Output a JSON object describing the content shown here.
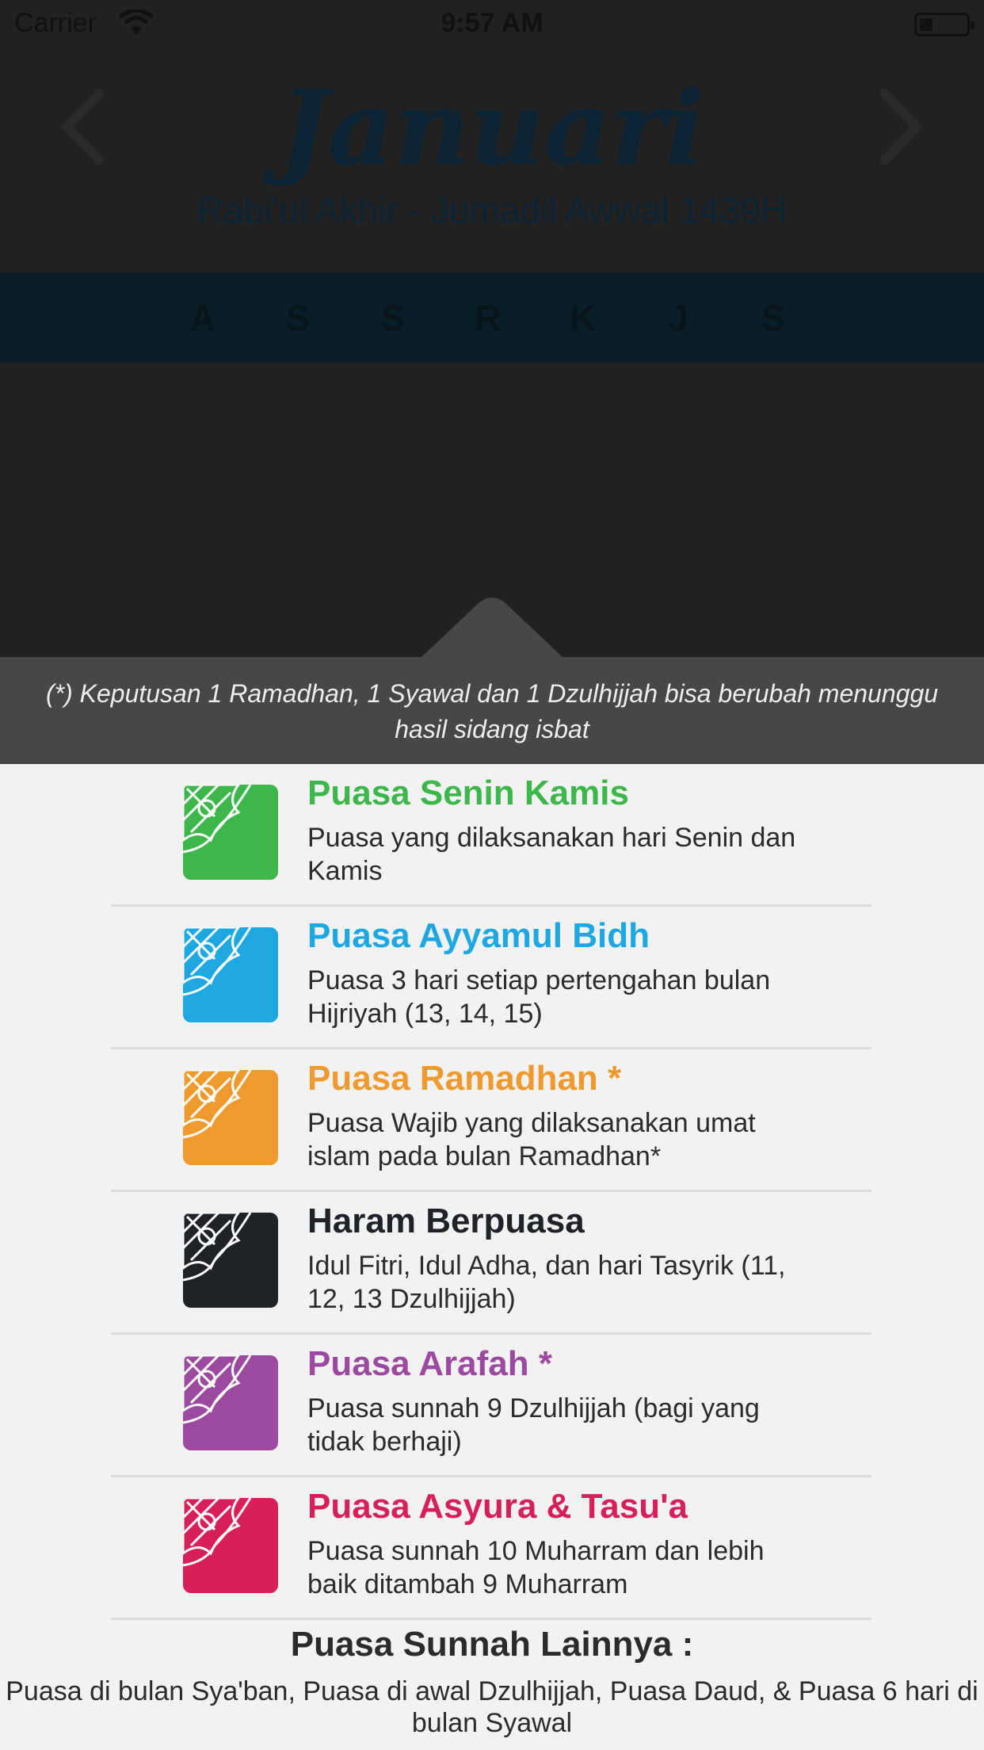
{
  "status_bar": {
    "carrier": "Carrier",
    "time": "9:57 AM"
  },
  "calendar": {
    "month": "Januari",
    "hijri_range": "Rabi'ul Akhir - Jumadil Awwal 1439H",
    "weekdays": [
      "A",
      "S",
      "S",
      "R",
      "K",
      "J",
      "S"
    ]
  },
  "notice": "(*) Keputusan 1 Ramadhan, 1 Syawal dan 1 Dzulhijjah bisa berubah menunggu hasil sidang isbat",
  "legend": [
    {
      "title": "Puasa Senin Kamis",
      "desc": "Puasa yang dilaksanakan hari Senin dan Kamis",
      "color": "#3db74b"
    },
    {
      "title": "Puasa Ayyamul Bidh",
      "desc": "Puasa 3 hari setiap pertengahan bulan Hijriyah (13, 14, 15)",
      "color": "#1ea7e0"
    },
    {
      "title": "Puasa Ramadhan *",
      "desc": "Puasa Wajib yang dilaksanakan umat islam pada bulan Ramadhan*",
      "color": "#ef9a2f"
    },
    {
      "title": "Haram Berpuasa",
      "desc": "Idul Fitri, Idul Adha, dan hari Tasyrik (11, 12, 13 Dzulhijjah)",
      "color": "#1f2227"
    },
    {
      "title": "Puasa Arafah *",
      "desc": "Puasa sunnah 9 Dzulhijjah (bagi yang tidak berhaji)",
      "color": "#9b4aa0"
    },
    {
      "title": "Puasa Asyura & Tasu'a",
      "desc": "Puasa sunnah 10 Muharram dan lebih baik ditambah 9 Muharram",
      "color": "#d71f5a"
    }
  ],
  "other": {
    "title": "Puasa Sunnah Lainnya :",
    "desc": "Puasa di bulan Sya'ban, Puasa di awal Dzulhijjah, Puasa Daud, & Puasa 6 hari di bulan Syawal"
  }
}
